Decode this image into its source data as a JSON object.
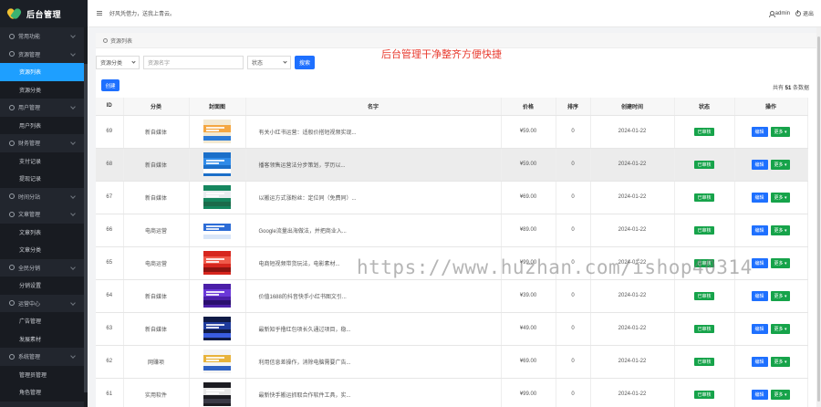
{
  "app": {
    "title": "后台管理"
  },
  "sidebar": {
    "groups": [
      {
        "label": "常用功能",
        "items": []
      },
      {
        "label": "资源管理",
        "items": [
          "资源列表",
          "资源分类"
        ]
      },
      {
        "label": "用户管理",
        "items": [
          "用户列表"
        ]
      },
      {
        "label": "财务管理",
        "items": [
          "支付记录",
          "提现记录"
        ]
      },
      {
        "label": "时间分站",
        "items": []
      },
      {
        "label": "文章管理",
        "items": [
          "文章列表",
          "文章分类"
        ]
      },
      {
        "label": "全民分销",
        "items": [
          "分销设置"
        ]
      },
      {
        "label": "运营中心",
        "items": [
          "广告管理",
          "发展素材"
        ]
      },
      {
        "label": "系统管理",
        "items": [
          "管理员管理",
          "角色管理"
        ]
      }
    ],
    "active_item": "资源列表"
  },
  "topbar": {
    "greeting": "好风凭借力，送我上青云。",
    "user": "admin",
    "logout": "退出"
  },
  "breadcrumb": "资源列表",
  "headline": "后台管理干净整齐方便快捷",
  "filters": {
    "category": "资源分类",
    "keyword_placeholder": "资源名字",
    "status": "状态",
    "search_button": "搜索"
  },
  "create_button": "创建",
  "total": {
    "prefix": "共有",
    "count": "51",
    "suffix": "条数据"
  },
  "table": {
    "headers": [
      "ID",
      "分类",
      "封面图",
      "名字",
      "价格",
      "排序",
      "创建时间",
      "状态",
      "操作"
    ],
    "rows": [
      {
        "id": "69",
        "category": "新自媒体",
        "name": "有关小红书运营：适般价搭短视频实现...",
        "price": "¥59.00",
        "sort": "0",
        "created": "2024-01-22",
        "status": "已审核"
      },
      {
        "id": "68",
        "category": "新自媒体",
        "name": "播客领售运营法分步策划，学历以...",
        "price": "¥59.00",
        "sort": "0",
        "created": "2024-01-22",
        "status": "已审核"
      },
      {
        "id": "67",
        "category": "新自媒体",
        "name": "以搬运方式涨粉丝：定位同（免费同）...",
        "price": "¥69.00",
        "sort": "0",
        "created": "2024-01-22",
        "status": "已审核"
      },
      {
        "id": "66",
        "category": "电商运营",
        "name": "Google流量出海做法，并把商业入...",
        "price": "¥89.00",
        "sort": "0",
        "created": "2024-01-22",
        "status": "已审核"
      },
      {
        "id": "65",
        "category": "电商运营",
        "name": "电商短视频带货玩法，电影素材...",
        "price": "¥99.00",
        "sort": "0",
        "created": "2024-01-22",
        "status": "已审核"
      },
      {
        "id": "64",
        "category": "新自媒体",
        "name": "价值1688的抖音快手小红书图文引...",
        "price": "¥39.00",
        "sort": "0",
        "created": "2024-01-22",
        "status": "已审核"
      },
      {
        "id": "63",
        "category": "新自媒体",
        "name": "最新知乎撸红包项长久通过项目，稳...",
        "price": "¥49.00",
        "sort": "0",
        "created": "2024-01-22",
        "status": "已审核"
      },
      {
        "id": "62",
        "category": "网赚项",
        "name": "利用信息差操作，消除电脑需要广告...",
        "price": "¥69.00",
        "sort": "0",
        "created": "2024-01-22",
        "status": "已审核"
      },
      {
        "id": "61",
        "category": "实用软件",
        "name": "最新快手搬运抓取合作软件工具，实...",
        "price": "¥99.00",
        "sort": "0",
        "created": "2024-01-22",
        "status": "已审核"
      }
    ],
    "edit_label": "编辑",
    "more_label": "更多"
  },
  "watermark": "https://www.huzhan.com/ishop40314",
  "colors": {
    "sidebar_bg": "#22262e",
    "active": "#1e9fff",
    "primary": "#1e70ff",
    "success": "#16a34a",
    "headline": "#e83a2e"
  }
}
